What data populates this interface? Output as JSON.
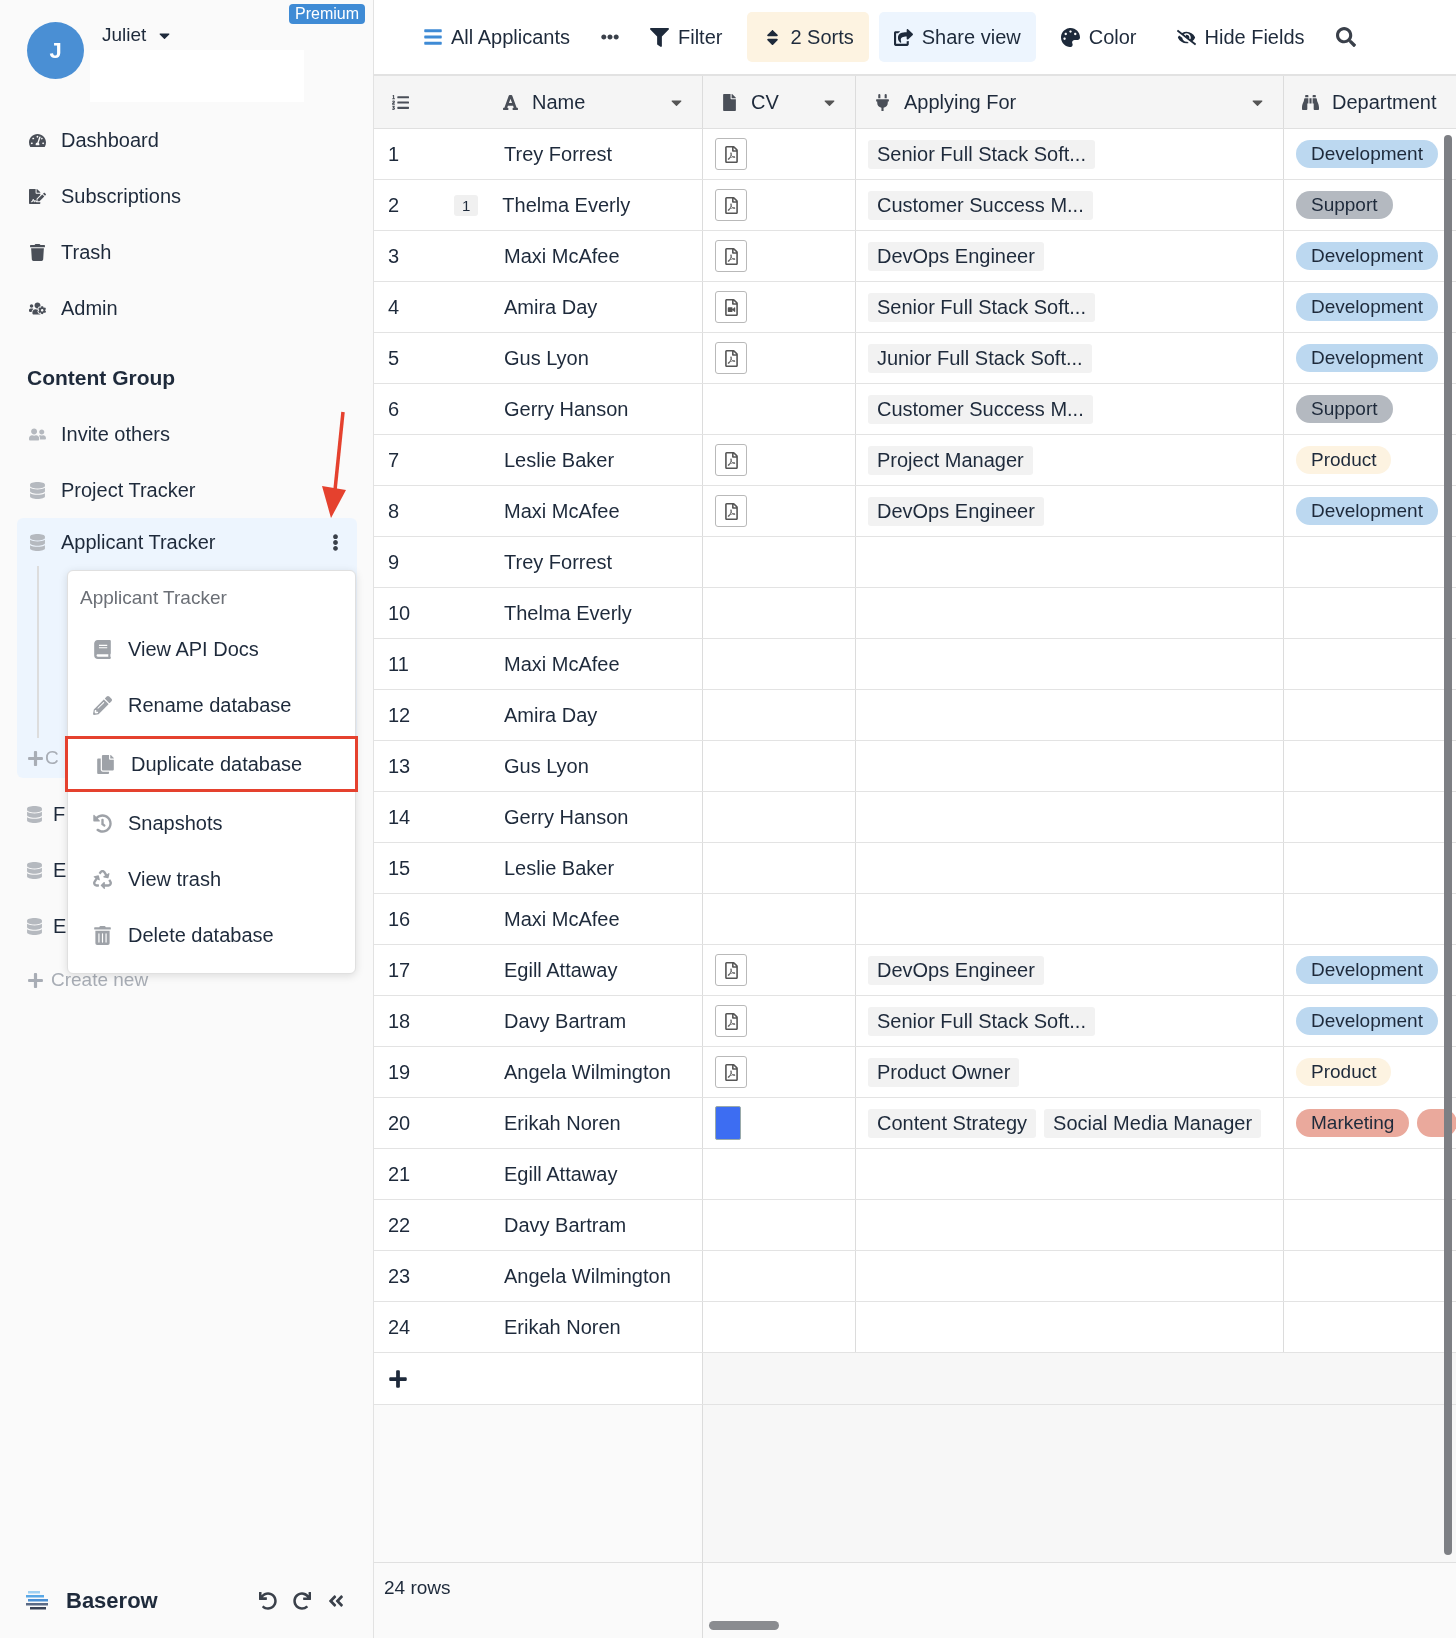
{
  "sidebar": {
    "user": {
      "initial": "J",
      "name": "Juliet"
    },
    "badge": "Premium",
    "nav": [
      "Dashboard",
      "Subscriptions",
      "Trash",
      "Admin"
    ],
    "group_title": "Content Group",
    "group_items": [
      {
        "label": "Invite others",
        "kind": "invite",
        "selected": false
      },
      {
        "label": "Project Tracker",
        "kind": "database",
        "selected": false
      },
      {
        "label": "Applicant Tracker",
        "kind": "database",
        "selected": true,
        "create_label": "C"
      },
      {
        "label": "F",
        "kind": "database",
        "selected": false
      },
      {
        "label": "E",
        "kind": "database",
        "selected": false
      },
      {
        "label": "E",
        "kind": "database",
        "selected": false
      }
    ],
    "create_new": "Create new",
    "brand": "Baserow"
  },
  "context_menu": {
    "title": "Applicant Tracker",
    "items": [
      {
        "label": "View API Docs",
        "highlighted": false
      },
      {
        "label": "Rename database",
        "highlighted": false
      },
      {
        "label": "Duplicate database",
        "highlighted": true
      },
      {
        "label": "Snapshots",
        "highlighted": false
      },
      {
        "label": "View trash",
        "highlighted": false
      },
      {
        "label": "Delete database",
        "highlighted": false
      }
    ]
  },
  "toolbar": {
    "view_name": "All Applicants",
    "items": [
      {
        "label": "Filter",
        "kind": "filter"
      },
      {
        "label": "2 Sorts",
        "kind": "sort"
      },
      {
        "label": "Share view",
        "kind": "share"
      },
      {
        "label": "Color",
        "kind": "color"
      },
      {
        "label": "Hide Fields",
        "kind": "hide"
      }
    ]
  },
  "table": {
    "columns": [
      {
        "label": "Name",
        "kind": "text"
      },
      {
        "label": "CV",
        "kind": "file"
      },
      {
        "label": "Applying For",
        "kind": "link"
      },
      {
        "label": "Department",
        "kind": "select"
      }
    ],
    "rows": [
      {
        "number": "1",
        "name": "Trey Forrest",
        "cv": {
          "kind": "pdf"
        },
        "applying": [
          "Senior Full Stack Soft..."
        ],
        "departments": [
          {
            "label": "Development",
            "color": "#bcd8f0"
          }
        ]
      },
      {
        "number": "2",
        "name": "Thelma Everly",
        "comments": "1",
        "cv": {
          "kind": "pdf"
        },
        "applying": [
          "Customer Success M..."
        ],
        "departments": [
          {
            "label": "Support",
            "color": "#b4b9c0"
          }
        ]
      },
      {
        "number": "3",
        "name": "Maxi McAfee",
        "cv": {
          "kind": "pdf"
        },
        "applying": [
          "DevOps Engineer"
        ],
        "departments": [
          {
            "label": "Development",
            "color": "#bcd8f0"
          }
        ]
      },
      {
        "number": "4",
        "name": "Amira Day",
        "cv": {
          "kind": "video"
        },
        "applying": [
          "Senior Full Stack Soft..."
        ],
        "departments": [
          {
            "label": "Development",
            "color": "#bcd8f0"
          }
        ]
      },
      {
        "number": "5",
        "name": "Gus Lyon",
        "cv": {
          "kind": "pdf"
        },
        "applying": [
          "Junior Full Stack Soft..."
        ],
        "departments": [
          {
            "label": "Development",
            "color": "#bcd8f0"
          }
        ]
      },
      {
        "number": "6",
        "name": "Gerry Hanson",
        "applying": [
          "Customer Success M..."
        ],
        "departments": [
          {
            "label": "Support",
            "color": "#b4b9c0"
          }
        ]
      },
      {
        "number": "7",
        "name": "Leslie Baker",
        "cv": {
          "kind": "pdf"
        },
        "applying": [
          "Project Manager"
        ],
        "departments": [
          {
            "label": "Product",
            "color": "#fdf3e1"
          }
        ]
      },
      {
        "number": "8",
        "name": "Maxi McAfee",
        "cv": {
          "kind": "pdf"
        },
        "applying": [
          "DevOps Engineer"
        ],
        "departments": [
          {
            "label": "Development",
            "color": "#bcd8f0"
          }
        ]
      },
      {
        "number": "9",
        "name": "Trey Forrest"
      },
      {
        "number": "10",
        "name": "Thelma Everly"
      },
      {
        "number": "11",
        "name": "Maxi McAfee"
      },
      {
        "number": "12",
        "name": "Amira Day"
      },
      {
        "number": "13",
        "name": "Gus Lyon"
      },
      {
        "number": "14",
        "name": "Gerry Hanson"
      },
      {
        "number": "15",
        "name": "Leslie Baker"
      },
      {
        "number": "16",
        "name": "Maxi McAfee"
      },
      {
        "number": "17",
        "name": "Egill Attaway",
        "cv": {
          "kind": "pdf"
        },
        "applying": [
          "DevOps Engineer"
        ],
        "departments": [
          {
            "label": "Development",
            "color": "#bcd8f0"
          }
        ]
      },
      {
        "number": "18",
        "name": "Davy Bartram",
        "cv": {
          "kind": "pdf"
        },
        "applying": [
          "Senior Full Stack Soft..."
        ],
        "departments": [
          {
            "label": "Development",
            "color": "#bcd8f0"
          }
        ]
      },
      {
        "number": "19",
        "name": "Angela Wilmington",
        "cv": {
          "kind": "pdf"
        },
        "applying": [
          "Product Owner"
        ],
        "departments": [
          {
            "label": "Product",
            "color": "#fdf3e1"
          }
        ]
      },
      {
        "number": "20",
        "name": "Erikah Noren",
        "cv": {
          "kind": "image"
        },
        "applying": [
          "Content Strategy",
          "Social Media Manager"
        ],
        "departments": [
          {
            "label": "Marketing",
            "color": "#eaa99c"
          },
          {
            "color": "#eaa99c"
          }
        ]
      },
      {
        "number": "21",
        "name": "Egill Attaway"
      },
      {
        "number": "22",
        "name": "Davy Bartram"
      },
      {
        "number": "23",
        "name": "Angela Wilmington"
      },
      {
        "number": "24",
        "name": "Erikah Noren"
      }
    ],
    "row_count": "24 rows"
  }
}
